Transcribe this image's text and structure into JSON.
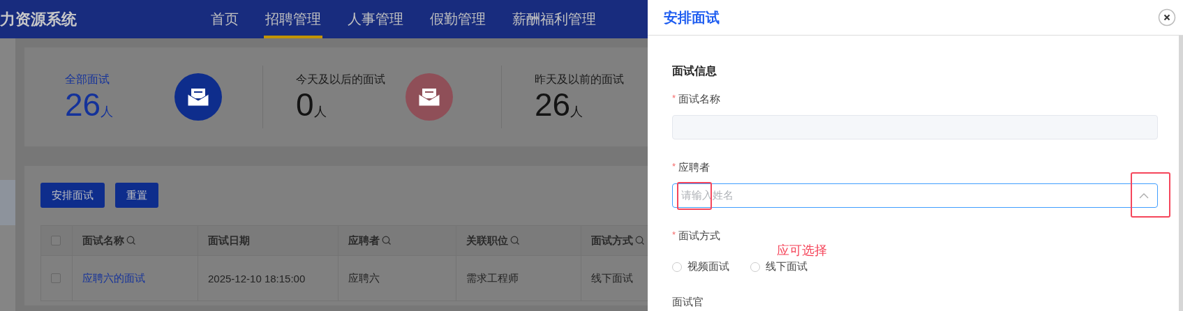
{
  "header": {
    "title": "力资源系统",
    "nav": [
      {
        "label": "首页",
        "selected": false
      },
      {
        "label": "招聘管理",
        "selected": true
      },
      {
        "label": "人事管理",
        "selected": false
      },
      {
        "label": "假勤管理",
        "selected": false
      },
      {
        "label": "薪酬福利管理",
        "selected": false
      }
    ]
  },
  "stats": [
    {
      "label": "全部面试",
      "value": "26",
      "unit": "人",
      "selected": true,
      "color": "#0e2d8c"
    },
    {
      "label": "今天及以后的面试",
      "value": "0",
      "unit": "人",
      "selected": false,
      "color": "#8f4f58"
    },
    {
      "label": "昨天及以前的面试",
      "value": "26",
      "unit": "人",
      "selected": false
    }
  ],
  "toolbar": {
    "buttons": [
      "安排面试",
      "重置"
    ]
  },
  "table": {
    "header_checked": false,
    "columns": [
      {
        "label": "面试名称",
        "searchable": true
      },
      {
        "label": "面试日期",
        "searchable": false
      },
      {
        "label": "应聘者",
        "searchable": true
      },
      {
        "label": "关联职位",
        "searchable": true
      },
      {
        "label": "面试方式",
        "searchable": true
      }
    ],
    "rows": [
      {
        "checked": false,
        "cells": [
          "应聘六的面试",
          "2025-12-10 18:15:00",
          "应聘六",
          "需求工程师",
          "线下面试"
        ]
      }
    ]
  },
  "drawer": {
    "title": "安排面试",
    "section": "面试信息",
    "fields": [
      {
        "kind": "text",
        "label": "面试名称",
        "required_mark": "*"
      },
      {
        "kind": "select",
        "label": "应聘者",
        "required_mark": "*",
        "placeholder": "请输入姓名",
        "focused": true,
        "expanded": true
      },
      {
        "kind": "radio",
        "label": "面试方式",
        "required_mark": "*",
        "options": [
          {
            "label": "视频面试",
            "selected": false
          },
          {
            "label": "线下面试",
            "selected": false
          }
        ]
      },
      {
        "kind": "label",
        "label": "面试官"
      }
    ]
  },
  "annotations": [
    {
      "kind": "placeholder-box"
    },
    {
      "kind": "arrow-box"
    },
    {
      "kind": "note",
      "text": "应可选择"
    }
  ]
}
